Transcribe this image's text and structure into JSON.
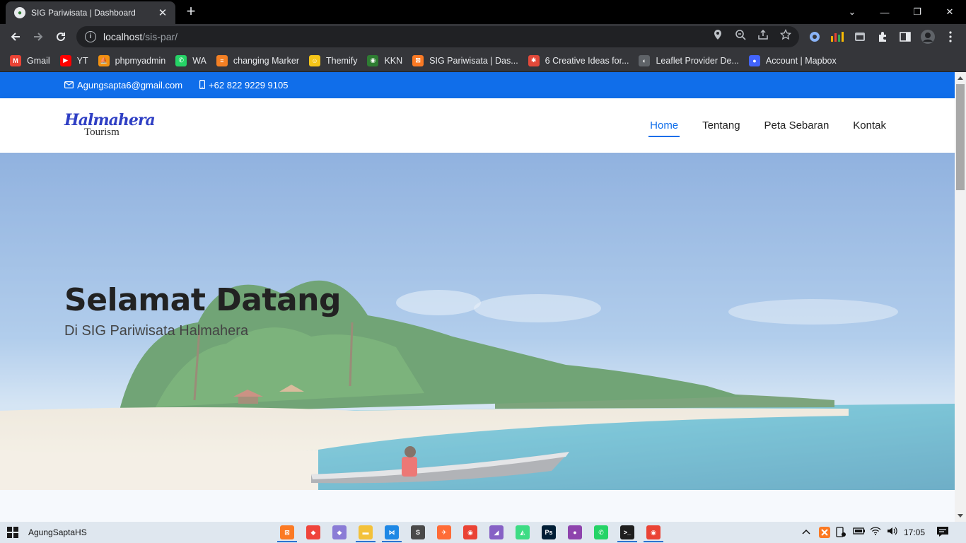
{
  "browser": {
    "tab_title": "SIG Pariwisata | Dashboard",
    "tab_close": "✕",
    "new_tab": "+",
    "url_host": "localhost",
    "url_path": "/sis-par/",
    "window_controls": [
      "⌄",
      "—",
      "❐",
      "✕"
    ]
  },
  "bookmarks": [
    {
      "label": "Gmail",
      "icon": "gmail-icon",
      "color": "#ea4335",
      "glyph": "M"
    },
    {
      "label": "YT",
      "icon": "youtube-icon",
      "color": "#ff0000",
      "glyph": "▶"
    },
    {
      "label": "phpmyadmin",
      "icon": "phpmyadmin-icon",
      "color": "#f29111",
      "glyph": "⛵"
    },
    {
      "label": "WA",
      "icon": "whatsapp-icon",
      "color": "#25d366",
      "glyph": "✆"
    },
    {
      "label": "changing Marker",
      "icon": "stackoverflow-icon",
      "color": "#f48024",
      "glyph": "≡"
    },
    {
      "label": "Themify",
      "icon": "themify-icon",
      "color": "#f5c518",
      "glyph": "☺"
    },
    {
      "label": "KKN",
      "icon": "kkn-icon",
      "color": "#2e7d32",
      "glyph": "◉"
    },
    {
      "label": "SIG Pariwisata | Das...",
      "icon": "xampp-icon",
      "color": "#fb7a24",
      "glyph": "⊠"
    },
    {
      "label": "6 Creative Ideas for...",
      "icon": "asterisk-icon",
      "color": "#e2493a",
      "glyph": "✱"
    },
    {
      "label": "Leaflet Provider De...",
      "icon": "globe-icon",
      "color": "#5f6368",
      "glyph": "◐"
    },
    {
      "label": "Account | Mapbox",
      "icon": "mapbox-icon",
      "color": "#4264fb",
      "glyph": "●"
    }
  ],
  "site": {
    "email": "Agungsapta6@gmail.com",
    "phone": "+62 822 9229 9105",
    "logo_line1": "Halmahera",
    "logo_line2": "Tourism",
    "nav": [
      "Home",
      "Tentang",
      "Peta Sebaran",
      "Kontak"
    ],
    "active_nav": "Home",
    "hero_title": "Selamat Datang",
    "hero_subtitle": "Di SIG Pariwisata Halmahera",
    "accent_color": "#106eea"
  },
  "taskbar": {
    "user": "AgungSaptaHS",
    "time": "17:05",
    "apps": [
      {
        "name": "xampp-app",
        "color": "#fb7a24",
        "glyph": "⊠"
      },
      {
        "name": "anydesk-app",
        "color": "#ef443b",
        "glyph": "◆"
      },
      {
        "name": "git-app",
        "color": "#8a7cd6",
        "glyph": "◆"
      },
      {
        "name": "file-explorer-app",
        "color": "#f3c13a",
        "glyph": "▬"
      },
      {
        "name": "vscode-app",
        "color": "#1e88e5",
        "glyph": "⋈"
      },
      {
        "name": "sublime-app",
        "color": "#4a4a4a",
        "glyph": "S"
      },
      {
        "name": "postman-app",
        "color": "#ff6c37",
        "glyph": "✈"
      },
      {
        "name": "chrome-app",
        "color": "#ea4335",
        "glyph": "◉"
      },
      {
        "name": "visual-studio-app",
        "color": "#8661c5",
        "glyph": "◢"
      },
      {
        "name": "android-studio-app",
        "color": "#3ddc84",
        "glyph": "◭"
      },
      {
        "name": "photoshop-app",
        "color": "#001e36",
        "glyph": "Ps"
      },
      {
        "name": "github-app",
        "color": "#8e44ad",
        "glyph": "●"
      },
      {
        "name": "whatsapp-app",
        "color": "#25d366",
        "glyph": "✆"
      },
      {
        "name": "cmd-app",
        "color": "#1e1e1e",
        "glyph": ">_"
      },
      {
        "name": "chrome-app-2",
        "color": "#ea4335",
        "glyph": "◉"
      }
    ]
  }
}
